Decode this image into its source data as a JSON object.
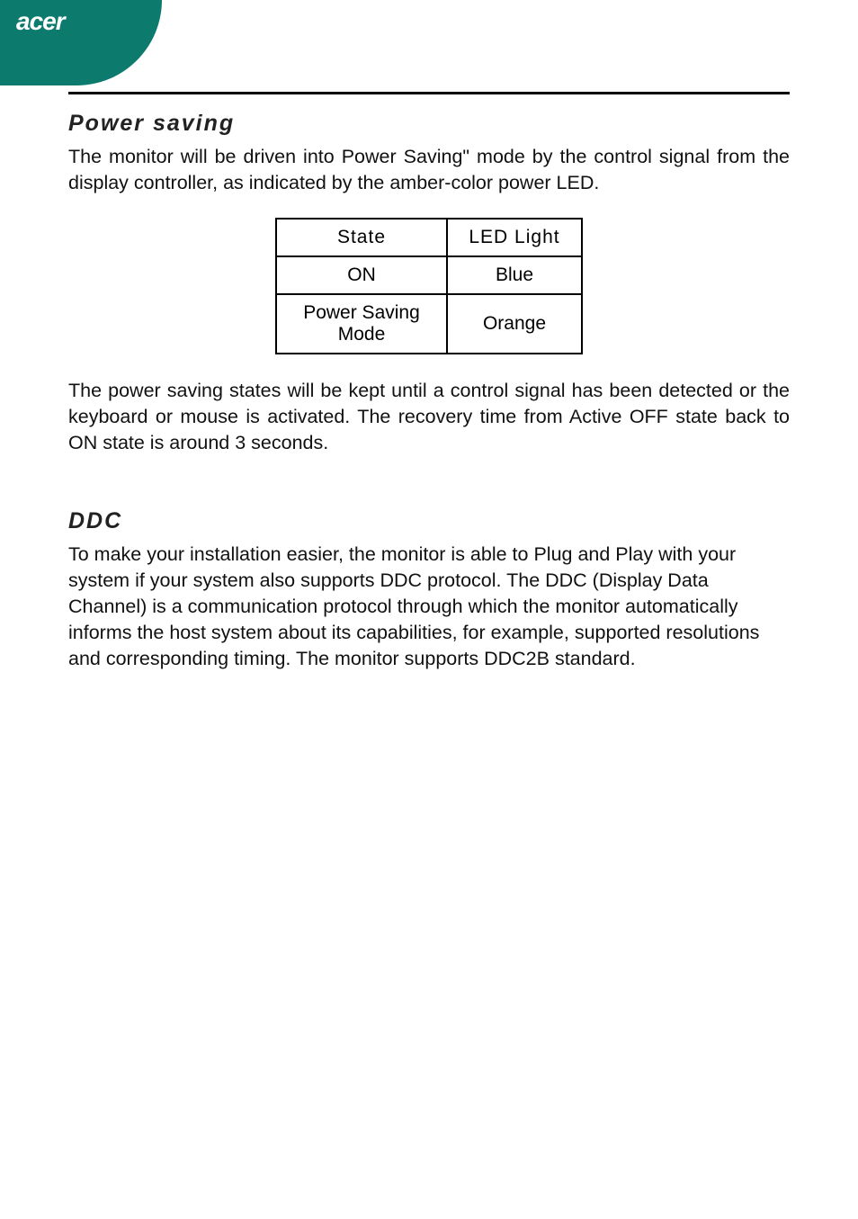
{
  "brand": "acer",
  "sections": {
    "power_saving": {
      "heading": "Power saving",
      "intro": "The monitor will be driven into Power Saving\" mode by the control signal from the display controller, as indicated by the amber-color power LED.",
      "outro": "The power saving states will be kept until a control signal has been detected or the keyboard or mouse is activated. The recovery time from Active OFF state back to ON state is around 3 seconds."
    },
    "ddc": {
      "heading": "DDC",
      "body": "To make your installation easier, the monitor is able to Plug and Play with your system if your system also supports DDC protocol. The DDC (Display Data Channel) is a communication protocol through which the monitor automatically informs the host system  about its capabilities, for example, supported resolutions and corresponding timing. The monitor supports DDC2B standard."
    }
  },
  "table": {
    "headers": {
      "state": "State",
      "led": "LED Light"
    },
    "rows": [
      {
        "state": "ON",
        "led": "Blue"
      },
      {
        "state": "Power Saving Mode",
        "led": "Orange"
      }
    ]
  }
}
